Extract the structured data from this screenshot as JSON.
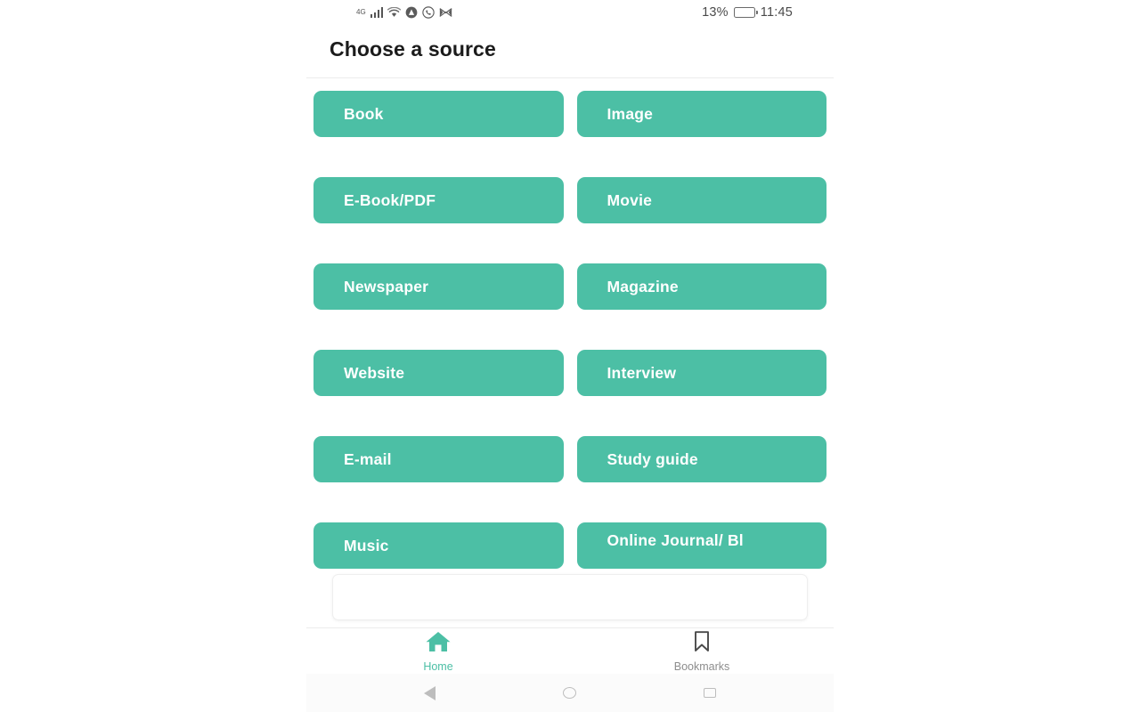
{
  "status_bar": {
    "network_type": "4G",
    "icons": [
      "signal-bars-icon",
      "wifi-icon",
      "adblock-icon",
      "whatsapp-icon",
      "gmail-icon"
    ],
    "battery_percent": "13%",
    "battery_level": 13,
    "battery_color": "#f0a63c",
    "time": "11:45"
  },
  "header": {
    "title": "Choose a source"
  },
  "theme": {
    "accent": "#4cbfa5",
    "button_text": "#ffffff",
    "title_color": "#1b1b1b",
    "background": "#ffffff"
  },
  "sources": [
    {
      "label": "Book"
    },
    {
      "label": "Image"
    },
    {
      "label": "E-Book/PDF"
    },
    {
      "label": "Movie"
    },
    {
      "label": "Newspaper"
    },
    {
      "label": "Magazine"
    },
    {
      "label": "Website"
    },
    {
      "label": "Interview"
    },
    {
      "label": "E-mail"
    },
    {
      "label": "Study guide"
    },
    {
      "label": "Music"
    },
    {
      "label": "Online Journal/ Bl"
    }
  ],
  "tabbar": {
    "tabs": [
      {
        "label": "Home",
        "icon": "home-icon",
        "active": true
      },
      {
        "label": "Bookmarks",
        "icon": "bookmark-icon",
        "active": false
      }
    ]
  },
  "android_nav": {
    "back": "back-icon",
    "home": "home-circle-icon",
    "recents": "recents-icon"
  }
}
